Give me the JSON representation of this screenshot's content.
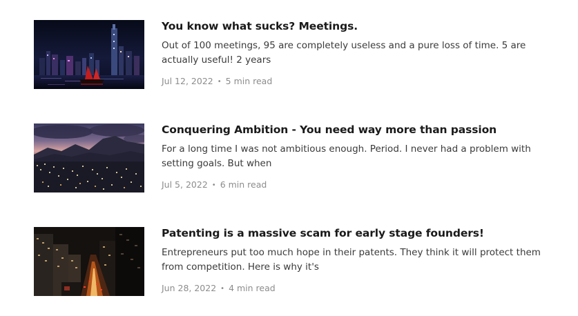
{
  "posts": [
    {
      "title": "You know what sucks? Meetings.",
      "excerpt": "Out of 100 meetings, 95 are completely useless and a pure loss of time. 5 are actually useful! 2 years",
      "date": "Jul 12, 2022",
      "separator": "•",
      "read_time": "5 min read",
      "thumbnail_icon": "night-harbor-skyline-image"
    },
    {
      "title": "Conquering Ambition - You need way more than passion",
      "excerpt": "For a long time I was not ambitious enough. Period. I never had a problem with setting goals. But when",
      "date": "Jul 5, 2022",
      "separator": "•",
      "read_time": "6 min read",
      "thumbnail_icon": "dusk-mountain-city-image"
    },
    {
      "title": "Patenting is a massive scam for early stage founders!",
      "excerpt": "Entrepreneurs put too much hope in their patents. They think it will protect them from competition. Here is why it's",
      "date": "Jun 28, 2022",
      "separator": "•",
      "read_time": "4 min read",
      "thumbnail_icon": "night-street-city-image"
    }
  ],
  "colors": {
    "title": "#1a1a1a",
    "excerpt": "#3a3a3a",
    "meta": "#8c8c8c",
    "background": "#ffffff"
  }
}
